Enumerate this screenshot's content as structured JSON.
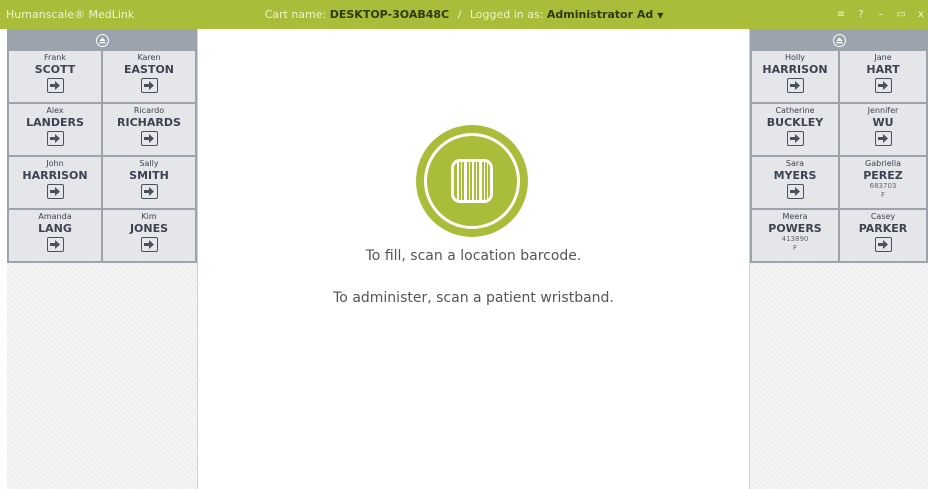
{
  "app": {
    "brand": "Humanscale® MedLink",
    "cart_label": "Cart name:",
    "cart_name": "DESKTOP-3OAB48C",
    "separator": "/",
    "logged_label": "Logged in as:",
    "user": "Administrator Ad",
    "window_controls": [
      "≡",
      "?",
      "–",
      "▭",
      "x"
    ]
  },
  "left_panel": {
    "patients": [
      {
        "first": "Frank",
        "last": "SCOTT"
      },
      {
        "first": "Karen",
        "last": "EASTON"
      },
      {
        "first": "Alex",
        "last": "LANDERS"
      },
      {
        "first": "Ricardo",
        "last": "RICHARDS"
      },
      {
        "first": "John",
        "last": "HARRISON"
      },
      {
        "first": "Sally",
        "last": "SMITH"
      },
      {
        "first": "Amanda",
        "last": "LANG"
      },
      {
        "first": "Kim",
        "last": "JONES"
      }
    ]
  },
  "right_panel": {
    "patients": [
      {
        "first": "Holly",
        "last": "HARRISON"
      },
      {
        "first": "Jane",
        "last": "HART"
      },
      {
        "first": "Catherine",
        "last": "BUCKLEY"
      },
      {
        "first": "Jennifer",
        "last": "WU"
      },
      {
        "first": "Sara",
        "last": "MYERS"
      },
      {
        "first": "Gabriella",
        "last": "PEREZ",
        "id": "683703",
        "sex": "F"
      },
      {
        "first": "Meera",
        "last": "POWERS",
        "id": "413890",
        "sex": "F"
      },
      {
        "first": "Casey",
        "last": "PARKER"
      }
    ]
  },
  "main": {
    "fill_message": "To fill, scan a location barcode.",
    "administer_message": "To administer, scan a patient wristband."
  },
  "colors": {
    "accent": "#a9bd3b",
    "panel_header": "#9ba3ad",
    "card": "#e4e6ea",
    "text": "#3c4451"
  }
}
